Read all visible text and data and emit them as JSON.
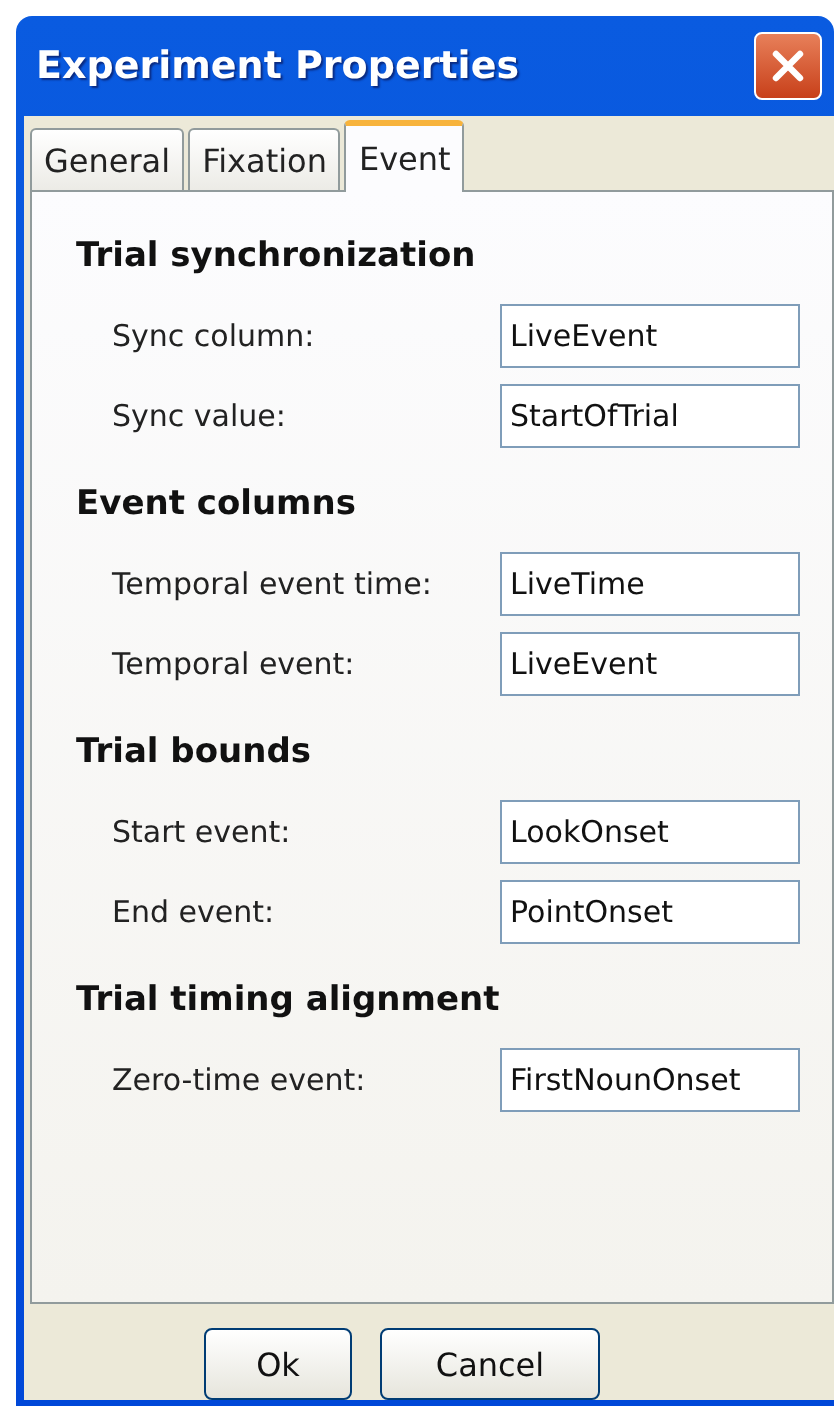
{
  "window": {
    "title": "Experiment Properties"
  },
  "tabs": [
    {
      "label": "General",
      "selected": false
    },
    {
      "label": "Fixation",
      "selected": false
    },
    {
      "label": "Event",
      "selected": true
    }
  ],
  "sections": [
    {
      "title": "Trial synchronization",
      "fields": [
        {
          "label": "Sync column:",
          "value": "LiveEvent"
        },
        {
          "label": "Sync value:",
          "value": "StartOfTrial"
        }
      ]
    },
    {
      "title": "Event columns",
      "fields": [
        {
          "label": "Temporal event time:",
          "value": "LiveTime"
        },
        {
          "label": "Temporal event:",
          "value": "LiveEvent"
        }
      ]
    },
    {
      "title": "Trial bounds",
      "fields": [
        {
          "label": "Start event:",
          "value": "LookOnset"
        },
        {
          "label": "End event:",
          "value": "PointOnset"
        }
      ]
    },
    {
      "title": "Trial timing alignment",
      "fields": [
        {
          "label": "Zero-time event:",
          "value": "FirstNounOnset"
        }
      ]
    }
  ],
  "buttons": [
    "Ok",
    "Cancel"
  ]
}
